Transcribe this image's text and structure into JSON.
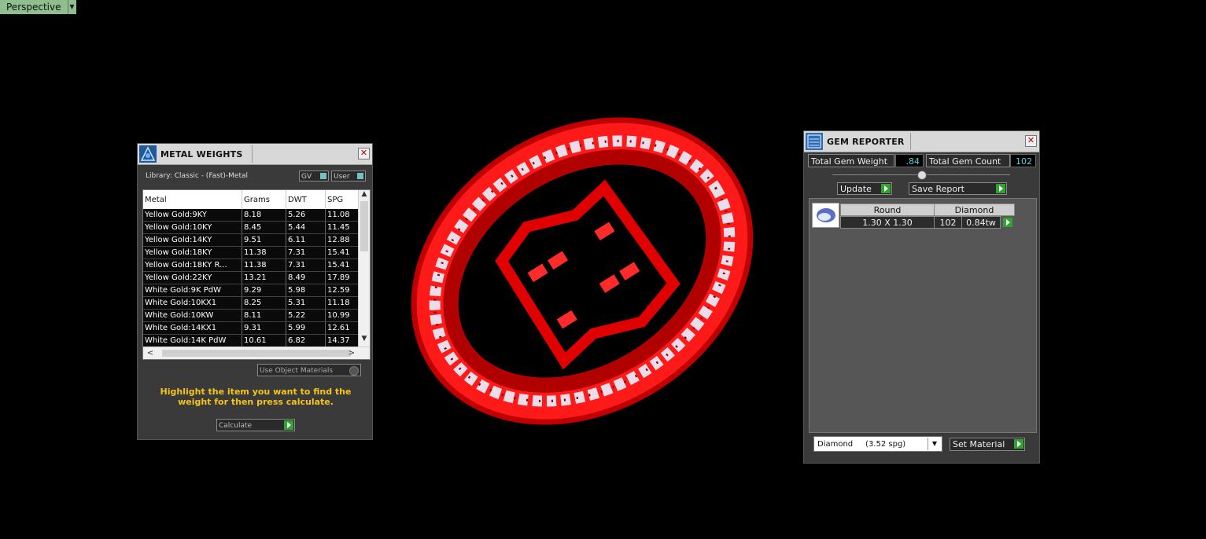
{
  "viewport": {
    "label": "Perspective"
  },
  "metal_weights": {
    "title": "METAL WEIGHTS",
    "library": "Library: Classic - (Fast)-Metal",
    "toggle_gv": "GV",
    "toggle_user": "User",
    "columns": [
      "Metal",
      "Grams",
      "DWT",
      "SPG"
    ],
    "rows": [
      [
        "Yellow Gold:9KY",
        "8.18",
        "5.26",
        "11.08"
      ],
      [
        "Yellow Gold:10KY",
        "8.45",
        "5.44",
        "11.45"
      ],
      [
        "Yellow Gold:14KY",
        "9.51",
        "6.11",
        "12.88"
      ],
      [
        "Yellow Gold:18KY",
        "11.38",
        "7.31",
        "15.41"
      ],
      [
        "Yellow Gold:18KY R...",
        "11.38",
        "7.31",
        "15.41"
      ],
      [
        "Yellow Gold:22KY",
        "13.21",
        "8.49",
        "17.89"
      ],
      [
        "White Gold:9K PdW",
        "9.29",
        "5.98",
        "12.59"
      ],
      [
        "White Gold:10KX1",
        "8.25",
        "5.31",
        "11.18"
      ],
      [
        "White Gold:10KW",
        "8.11",
        "5.22",
        "10.99"
      ],
      [
        "White Gold:14KX1",
        "9.31",
        "5.99",
        "12.61"
      ],
      [
        "White Gold:14K PdW",
        "10.61",
        "6.82",
        "14.37"
      ]
    ],
    "use_object_materials": "Use Object Materials",
    "hint": "Highlight the item you want to find the weight for then press calculate.",
    "calculate": "Calculate"
  },
  "gem_reporter": {
    "title": "GEM REPORTER",
    "total_weight_label": "Total Gem Weight",
    "total_weight_value": ".84",
    "total_count_label": "Total Gem Count",
    "total_count_value": "102",
    "update": "Update",
    "save_report": "Save Report",
    "table": {
      "shape_header": "Round",
      "type_header": "Diamond",
      "size": "1.30 X 1.30",
      "count": "102",
      "weight": "0.84tw"
    },
    "material_select": "Diamond     (3.52 spg)",
    "set_material": "Set Material"
  },
  "colors": {
    "ring": "#e00000",
    "gem": "#cfe3ff",
    "accent": "#2fa52f",
    "value": "#4fd4e8",
    "hint": "#f5c518"
  }
}
